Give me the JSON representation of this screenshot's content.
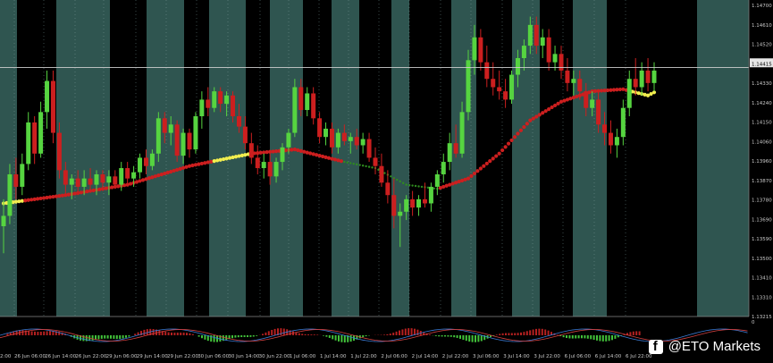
{
  "chart_data": {
    "type": "candlestick",
    "price_axis_labels": [
      "1.14700",
      "1.14610",
      "1.14520",
      "1.14415",
      "1.14330",
      "1.14240",
      "1.14150",
      "1.14060",
      "1.13960",
      "1.13870",
      "1.13780",
      "1.13690",
      "1.13590",
      "1.13500",
      "1.13410",
      "1.13310",
      "1.13215"
    ],
    "current_price_label": "1.14415",
    "time_axis_labels": [
      "2:00",
      "26 Jun 06:00",
      "26 Jun 14:00",
      "26 Jun 22:00",
      "29 Jun 06:00",
      "29 Jun 14:00",
      "29 Jun 22:00",
      "30 Jun 06:00",
      "30 Jun 14:00",
      "30 Jun 22:00",
      "1 Jul 06:00",
      "1 Jul 14:00",
      "1 Jul 22:00",
      "2 Jul 06:00",
      "2 Jul 14:00",
      "2 Jul 22:00",
      "3 Jul 06:00",
      "3 Jul 14:00",
      "3 Jul 22:00",
      "6 Jul 06:00",
      "6 Jul 14:00",
      "6 Jul 22:00"
    ],
    "ohlc": [
      [
        1.1365,
        1.1378,
        1.1352,
        1.137
      ],
      [
        1.137,
        1.1395,
        1.1366,
        1.139
      ],
      [
        1.139,
        1.1398,
        1.1378,
        1.1384
      ],
      [
        1.1384,
        1.14,
        1.138,
        1.1395
      ],
      [
        1.1395,
        1.142,
        1.1392,
        1.1415
      ],
      [
        1.1415,
        1.1418,
        1.1395,
        1.14
      ],
      [
        1.14,
        1.1425,
        1.1398,
        1.142
      ],
      [
        1.142,
        1.144,
        1.1412,
        1.1435
      ],
      [
        1.1435,
        1.144,
        1.1405,
        1.141
      ],
      [
        1.141,
        1.1415,
        1.1388,
        1.1392
      ],
      [
        1.1392,
        1.1396,
        1.138,
        1.1385
      ],
      [
        1.1385,
        1.139,
        1.1378,
        1.1388
      ],
      [
        1.1388,
        1.1392,
        1.138,
        1.1384
      ],
      [
        1.1384,
        1.1392,
        1.138,
        1.1388
      ],
      [
        1.1388,
        1.1393,
        1.1382,
        1.1385
      ],
      [
        1.1385,
        1.1392,
        1.138,
        1.139
      ],
      [
        1.139,
        1.1392,
        1.1382,
        1.1386
      ],
      [
        1.1386,
        1.1392,
        1.138,
        1.1389
      ],
      [
        1.1389,
        1.1392,
        1.1383,
        1.1385
      ],
      [
        1.1385,
        1.1396,
        1.1382,
        1.1393
      ],
      [
        1.1393,
        1.1396,
        1.1385,
        1.1388
      ],
      [
        1.1388,
        1.1394,
        1.1384,
        1.1391
      ],
      [
        1.1391,
        1.14,
        1.1388,
        1.1398
      ],
      [
        1.1398,
        1.1402,
        1.139,
        1.1394
      ],
      [
        1.1394,
        1.1402,
        1.1392,
        1.14
      ],
      [
        1.14,
        1.142,
        1.1396,
        1.1417
      ],
      [
        1.1417,
        1.142,
        1.1405,
        1.141
      ],
      [
        1.141,
        1.1418,
        1.1404,
        1.1414
      ],
      [
        1.1414,
        1.1416,
        1.1396,
        1.1399
      ],
      [
        1.1399,
        1.1412,
        1.1395,
        1.141
      ],
      [
        1.141,
        1.1412,
        1.1398,
        1.1402
      ],
      [
        1.1402,
        1.142,
        1.14,
        1.1418
      ],
      [
        1.1418,
        1.143,
        1.1412,
        1.1426
      ],
      [
        1.1426,
        1.1432,
        1.1418,
        1.1422
      ],
      [
        1.1422,
        1.1432,
        1.142,
        1.143
      ],
      [
        1.143,
        1.1432,
        1.142,
        1.1424
      ],
      [
        1.1424,
        1.143,
        1.1418,
        1.1428
      ],
      [
        1.1428,
        1.143,
        1.1415,
        1.1418
      ],
      [
        1.1418,
        1.1424,
        1.141,
        1.1413
      ],
      [
        1.1413,
        1.1418,
        1.1402,
        1.1405
      ],
      [
        1.1405,
        1.141,
        1.1395,
        1.1398
      ],
      [
        1.1398,
        1.1404,
        1.139,
        1.1393
      ],
      [
        1.1393,
        1.14,
        1.1388,
        1.1396
      ],
      [
        1.1396,
        1.14,
        1.1385,
        1.1389
      ],
      [
        1.1389,
        1.1398,
        1.1386,
        1.1396
      ],
      [
        1.1396,
        1.1405,
        1.1392,
        1.1403
      ],
      [
        1.1403,
        1.1412,
        1.14,
        1.141
      ],
      [
        1.141,
        1.1436,
        1.1408,
        1.1432
      ],
      [
        1.1432,
        1.1436,
        1.1418,
        1.1421
      ],
      [
        1.1421,
        1.1432,
        1.1418,
        1.1429
      ],
      [
        1.1429,
        1.1432,
        1.1414,
        1.1417
      ],
      [
        1.1417,
        1.142,
        1.1405,
        1.1408
      ],
      [
        1.1408,
        1.1415,
        1.1404,
        1.1412
      ],
      [
        1.1412,
        1.1415,
        1.14,
        1.1403
      ],
      [
        1.1403,
        1.1412,
        1.14,
        1.141
      ],
      [
        1.141,
        1.1414,
        1.1404,
        1.1406
      ],
      [
        1.1406,
        1.141,
        1.14,
        1.1408
      ],
      [
        1.1408,
        1.1412,
        1.1402,
        1.1404
      ],
      [
        1.1404,
        1.141,
        1.14,
        1.1407
      ],
      [
        1.1407,
        1.141,
        1.1396,
        1.1398
      ],
      [
        1.1398,
        1.1403,
        1.139,
        1.1394
      ],
      [
        1.1394,
        1.14,
        1.1384,
        1.1386
      ],
      [
        1.1386,
        1.1392,
        1.1376,
        1.138
      ],
      [
        1.138,
        1.1388,
        1.1364,
        1.137
      ],
      [
        1.137,
        1.1376,
        1.1355,
        1.1372
      ],
      [
        1.1372,
        1.138,
        1.1368,
        1.1378
      ],
      [
        1.1378,
        1.1382,
        1.137,
        1.1374
      ],
      [
        1.1374,
        1.138,
        1.137,
        1.1378
      ],
      [
        1.1378,
        1.1386,
        1.1374,
        1.1376
      ],
      [
        1.1376,
        1.1386,
        1.1372,
        1.1384
      ],
      [
        1.1384,
        1.1392,
        1.138,
        1.139
      ],
      [
        1.139,
        1.14,
        1.1386,
        1.1396
      ],
      [
        1.1396,
        1.141,
        1.1392,
        1.1405
      ],
      [
        1.1405,
        1.1414,
        1.1398,
        1.14
      ],
      [
        1.14,
        1.1425,
        1.1398,
        1.142
      ],
      [
        1.142,
        1.145,
        1.1416,
        1.1445
      ],
      [
        1.1445,
        1.1462,
        1.1438,
        1.1456
      ],
      [
        1.1456,
        1.146,
        1.144,
        1.1444
      ],
      [
        1.1444,
        1.1452,
        1.1432,
        1.1436
      ],
      [
        1.1436,
        1.1444,
        1.1428,
        1.1432
      ],
      [
        1.1432,
        1.144,
        1.1426,
        1.143
      ],
      [
        1.143,
        1.1436,
        1.1422,
        1.1426
      ],
      [
        1.1426,
        1.144,
        1.1424,
        1.1438
      ],
      [
        1.1438,
        1.145,
        1.1432,
        1.1446
      ],
      [
        1.1446,
        1.1455,
        1.144,
        1.1452
      ],
      [
        1.1452,
        1.1466,
        1.1448,
        1.1462
      ],
      [
        1.1462,
        1.1466,
        1.1448,
        1.1452
      ],
      [
        1.1452,
        1.146,
        1.1446,
        1.1456
      ],
      [
        1.1456,
        1.146,
        1.144,
        1.1444
      ],
      [
        1.1444,
        1.1452,
        1.144,
        1.1448
      ],
      [
        1.1448,
        1.1452,
        1.1436,
        1.144
      ],
      [
        1.144,
        1.1446,
        1.143,
        1.1434
      ],
      [
        1.1434,
        1.144,
        1.1428,
        1.1436
      ],
      [
        1.1436,
        1.144,
        1.1426,
        1.143
      ],
      [
        1.143,
        1.1434,
        1.1418,
        1.1422
      ],
      [
        1.1422,
        1.143,
        1.1418,
        1.1426
      ],
      [
        1.1426,
        1.143,
        1.141,
        1.1414
      ],
      [
        1.1414,
        1.142,
        1.1404,
        1.141
      ],
      [
        1.141,
        1.1416,
        1.14,
        1.1404
      ],
      [
        1.1404,
        1.1412,
        1.1398,
        1.1408
      ],
      [
        1.1408,
        1.1426,
        1.1404,
        1.1422
      ],
      [
        1.1422,
        1.144,
        1.1418,
        1.1436
      ],
      [
        1.1436,
        1.1446,
        1.1428,
        1.1432
      ],
      [
        1.1432,
        1.1444,
        1.1428,
        1.144
      ],
      [
        1.144,
        1.1446,
        1.143,
        1.1434
      ],
      [
        1.1434,
        1.1444,
        1.143,
        1.144
      ]
    ],
    "ma_points": [
      [
        0,
        1.1376
      ],
      [
        10,
        1.138
      ],
      [
        20,
        1.1385
      ],
      [
        30,
        1.1394
      ],
      [
        40,
        1.14
      ],
      [
        47,
        1.1402
      ],
      [
        55,
        1.1396
      ],
      [
        60,
        1.1393
      ],
      [
        65,
        1.1385
      ],
      [
        70,
        1.1383
      ],
      [
        75,
        1.1388
      ],
      [
        80,
        1.14
      ],
      [
        85,
        1.1416
      ],
      [
        90,
        1.1425
      ],
      [
        95,
        1.143
      ],
      [
        100,
        1.1431
      ],
      [
        104,
        1.1428
      ],
      [
        108,
        1.1434
      ]
    ],
    "ma_yellow_segments": [
      [
        0,
        3
      ],
      [
        34,
        40
      ],
      [
        101,
        105
      ]
    ],
    "ma_green_segments": [
      [
        55,
        70
      ]
    ],
    "colors": {
      "up": "#56d440",
      "down": "#cc1f1f",
      "ma": "#cc1f1f",
      "ma_neutral": "#f2ee4f",
      "ma_green": "#2f8c1f",
      "band": "#2f5550",
      "bg": "#000000",
      "axis_text": "#c9c9c9"
    }
  },
  "watermark": {
    "text": "@ETO Markets",
    "icon": "facebook-icon"
  }
}
